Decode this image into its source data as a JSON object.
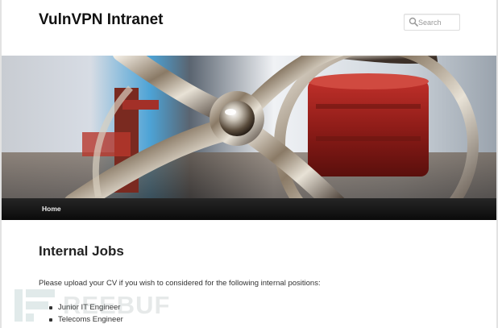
{
  "site": {
    "title": "VulnVPN Intranet"
  },
  "search": {
    "placeholder": "Search"
  },
  "nav": {
    "items": [
      {
        "label": "Home"
      }
    ]
  },
  "main": {
    "heading": "Internal Jobs",
    "intro": "Please upload your CV if you wish to considered for the following internal positions:",
    "jobs": [
      "Junior IT Engineer",
      "Telecoms Engineer"
    ]
  },
  "watermark": {
    "text": "REEBUF"
  },
  "icons": {
    "search": "search-icon",
    "watermark_logo": "freebuf-logo-icon"
  }
}
